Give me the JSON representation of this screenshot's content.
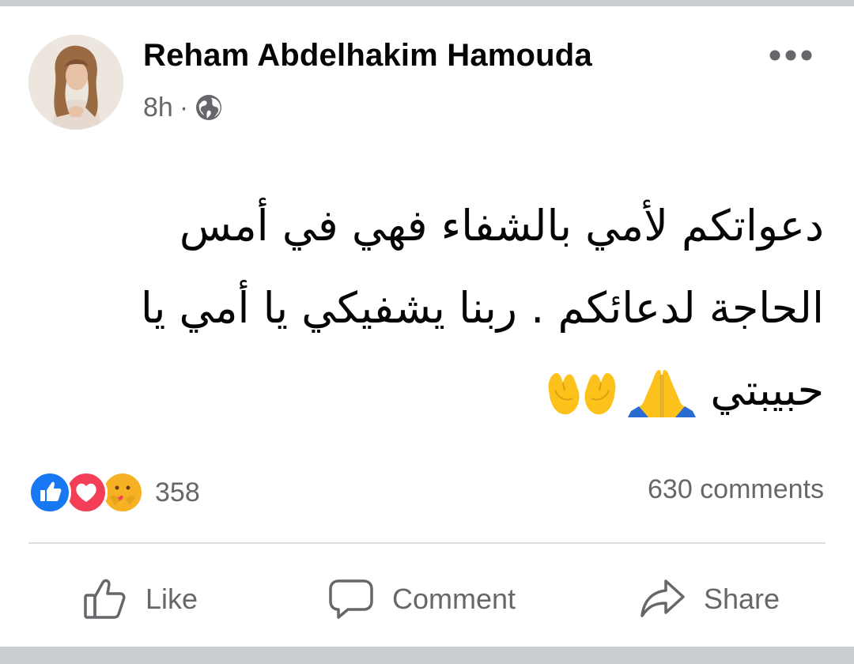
{
  "post": {
    "author": "Reham Abdelhakim Hamouda",
    "time": "8h",
    "separator": "·",
    "privacy_icon": "globe-icon",
    "text_lines": [
      "دعواتكم لأمي بالشفاء فهي في أمس",
      "الحاجة لدعائكم . ربنا يشفيكي يا أمي يا",
      "حبيبتي"
    ],
    "emojis": [
      "🙏",
      "🤲"
    ]
  },
  "reactions": {
    "icons": [
      "like-reaction-icon",
      "love-reaction-icon",
      "care-reaction-icon"
    ],
    "count": "358"
  },
  "comments": {
    "count_label": "630 comments"
  },
  "actions": {
    "like_label": "Like",
    "comment_label": "Comment",
    "share_label": "Share"
  },
  "colors": {
    "text_primary": "#050505",
    "text_secondary": "#65676b",
    "like_blue": "#1877f2",
    "love_red": "#f33e58",
    "care_yellow": "#f7b125",
    "frame_gray": "#c9ccd1"
  }
}
